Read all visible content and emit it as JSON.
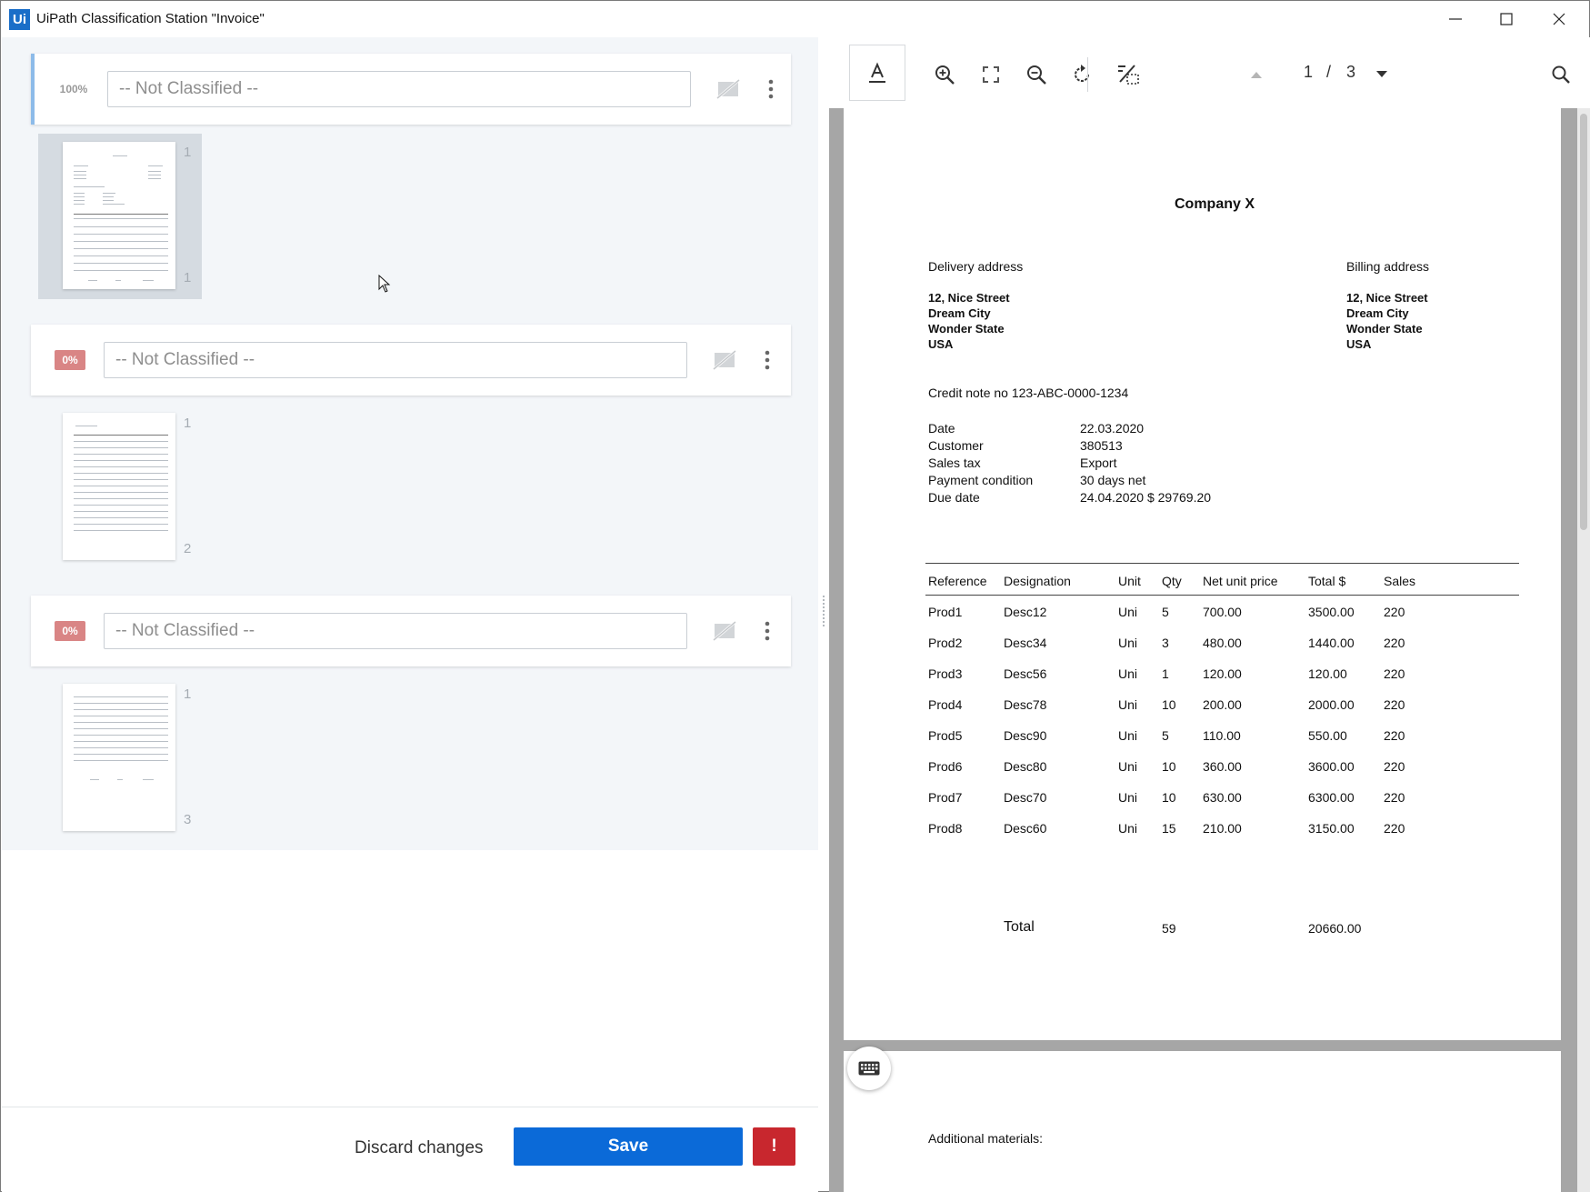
{
  "window": {
    "app_icon_text": "Ui",
    "title": "UiPath Classification Station \"Invoice\""
  },
  "groups": [
    {
      "confidence": "100%",
      "classification": "-- Not Classified --",
      "pages": [
        {
          "page_index": "1",
          "page_number": "1"
        }
      ]
    },
    {
      "confidence": "0%",
      "classification": "-- Not Classified --",
      "pages": [
        {
          "page_index": "1",
          "page_number": "2"
        }
      ]
    },
    {
      "confidence": "0%",
      "classification": "-- Not Classified --",
      "pages": [
        {
          "page_index": "1",
          "page_number": "3"
        }
      ]
    }
  ],
  "footer": {
    "discard_label": "Discard changes",
    "save_label": "Save",
    "alert_label": "!"
  },
  "viewer": {
    "current_page": "1",
    "separator": "/",
    "total_pages": "3"
  },
  "document": {
    "company": "Company X",
    "delivery_label": "Delivery address",
    "billing_label": "Billing address",
    "delivery_address": [
      "12, Nice Street",
      "Dream City",
      "Wonder State",
      "USA"
    ],
    "billing_address": [
      "12, Nice Street",
      "Dream City",
      "Wonder State",
      "USA"
    ],
    "credit_note": "Credit note no 123-ABC-0000-1234",
    "details": [
      {
        "label": "Date",
        "value": "22.03.2020"
      },
      {
        "label": "Customer",
        "value": "380513"
      },
      {
        "label": "Sales tax",
        "value": "Export"
      },
      {
        "label": "Payment condition",
        "value": "30 days net"
      },
      {
        "label": "Due date",
        "value": "24.04.2020 $ 29769.20"
      }
    ],
    "table_headers": [
      "Reference",
      "Designation",
      "Unit",
      "Qty",
      "Net unit price",
      "Total $",
      "Sales"
    ],
    "table_rows": [
      [
        "Prod1",
        "Desc12",
        "Uni",
        "5",
        "700.00",
        "3500.00",
        "220"
      ],
      [
        "Prod2",
        "Desc34",
        "Uni",
        "3",
        "480.00",
        "1440.00",
        "220"
      ],
      [
        "Prod3",
        "Desc56",
        "Uni",
        "1",
        "120.00",
        "120.00",
        "220"
      ],
      [
        "Prod4",
        "Desc78",
        "Uni",
        "10",
        "200.00",
        "2000.00",
        "220"
      ],
      [
        "Prod5",
        "Desc90",
        "Uni",
        "5",
        "110.00",
        "550.00",
        "220"
      ],
      [
        "Prod6",
        "Desc80",
        "Uni",
        "10",
        "360.00",
        "3600.00",
        "220"
      ],
      [
        "Prod7",
        "Desc70",
        "Uni",
        "10",
        "630.00",
        "6300.00",
        "220"
      ],
      [
        "Prod8",
        "Desc60",
        "Uni",
        "15",
        "210.00",
        "3150.00",
        "220"
      ]
    ],
    "total_label": "Total",
    "total_qty": "59",
    "total_amount": "20660.00",
    "page2_text": "Additional materials:"
  },
  "colors": {
    "primary": "#0b6ad8",
    "danger": "#c8272e",
    "low_confidence": "#d98585",
    "active_marker": "#8dbbe9"
  },
  "icons": {
    "tools": [
      "text-select-icon",
      "zoom-in-icon",
      "fit-page-icon",
      "zoom-out-icon",
      "rotate-icon",
      "region-select-icon"
    ],
    "nav": [
      "page-up-icon",
      "page-down-icon",
      "search-icon"
    ],
    "group": [
      "hide-page-icon",
      "more-vert-icon"
    ]
  }
}
